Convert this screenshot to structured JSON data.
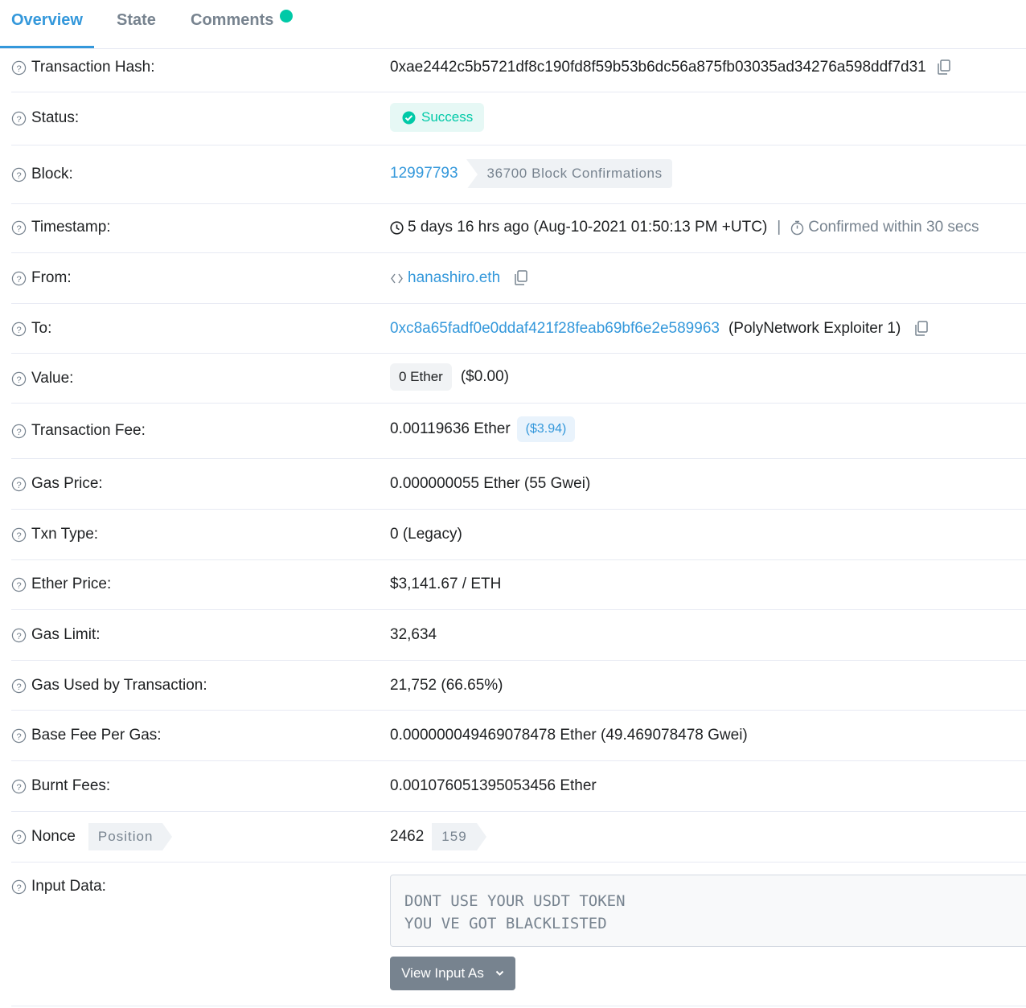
{
  "tabs": [
    {
      "label": "Overview",
      "active": true
    },
    {
      "label": "State",
      "active": false
    },
    {
      "label": "Comments",
      "active": false
    }
  ],
  "rows": {
    "tx_hash": {
      "label": "Transaction Hash:",
      "value": "0xae2442c5b5721df8c190fd8f59b53b6dc56a875fb03035ad34276a598ddf7d31"
    },
    "status": {
      "label": "Status:",
      "value": "Success"
    },
    "block": {
      "label": "Block:",
      "number": "12997793",
      "confirmations": "36700 Block Confirmations"
    },
    "timestamp": {
      "label": "Timestamp:",
      "value": "5 days 16 hrs ago (Aug-10-2021 01:50:13 PM +UTC)",
      "separator": "|",
      "confirmed": "Confirmed within 30 secs"
    },
    "from": {
      "label": "From:",
      "value": "hanashiro.eth"
    },
    "to": {
      "label": "To:",
      "address": "0xc8a65fadf0e0ddaf421f28feab69bf6e2e589963",
      "name": "(PolyNetwork Exploiter 1)"
    },
    "value": {
      "label": "Value:",
      "amount": "0 Ether",
      "usd": "($0.00)"
    },
    "tx_fee": {
      "label": "Transaction Fee:",
      "amount": "0.00119636 Ether",
      "usd": "($3.94)"
    },
    "gas_price": {
      "label": "Gas Price:",
      "value": "0.000000055 Ether (55 Gwei)"
    },
    "txn_type": {
      "label": "Txn Type:",
      "value": "0 (Legacy)"
    },
    "ether_price": {
      "label": "Ether Price:",
      "value": "$3,141.67 / ETH"
    },
    "gas_limit": {
      "label": "Gas Limit:",
      "value": "32,634"
    },
    "gas_used": {
      "label": "Gas Used by Transaction:",
      "value": "21,752 (66.65%)"
    },
    "base_fee": {
      "label": "Base Fee Per Gas:",
      "value": "0.000000049469078478 Ether (49.469078478 Gwei)"
    },
    "burnt_fees": {
      "label": "Burnt Fees:",
      "value": "0.001076051395053456 Ether"
    },
    "nonce": {
      "label": "Nonce",
      "position_label": "Position",
      "nonce_value": "2462",
      "position_value": "159"
    },
    "input_data": {
      "label": "Input Data:",
      "text": "DONT USE YOUR USDT TOKEN\nYOU VE GOT BLACKLISTED",
      "button": "View Input As"
    }
  },
  "colors": {
    "accent": "#3498db",
    "success": "#00c9a7",
    "muted": "#77838f"
  }
}
